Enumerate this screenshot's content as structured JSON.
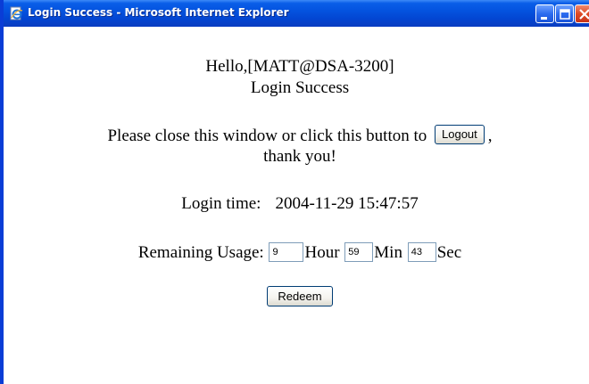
{
  "window": {
    "title": "Login Success - Microsoft Internet Explorer",
    "icon": "ie-page-icon",
    "controls": [
      "minimize-icon",
      "maximize-icon",
      "close-icon"
    ]
  },
  "page": {
    "greeting": "Hello,[MATT@DSA-3200]",
    "status": "Login Success",
    "close_prompt": "Please close this window or click this button to",
    "logout_label": "Logout",
    "close_suffix": ",",
    "thanks": "thank you!",
    "login_time_label": "Login time:",
    "login_time_value": "2004-11-29 15:47:57",
    "remaining_label": "Remaining Usage:",
    "hour_value": "9",
    "hour_unit": "Hour",
    "min_value": "59",
    "min_unit": "Min",
    "sec_value": "43",
    "sec_unit": "Sec",
    "redeem_label": "Redeem"
  },
  "colors": {
    "titlebar": "#0453df",
    "close_button": "#de4a25",
    "field_border": "#7f9db9"
  }
}
